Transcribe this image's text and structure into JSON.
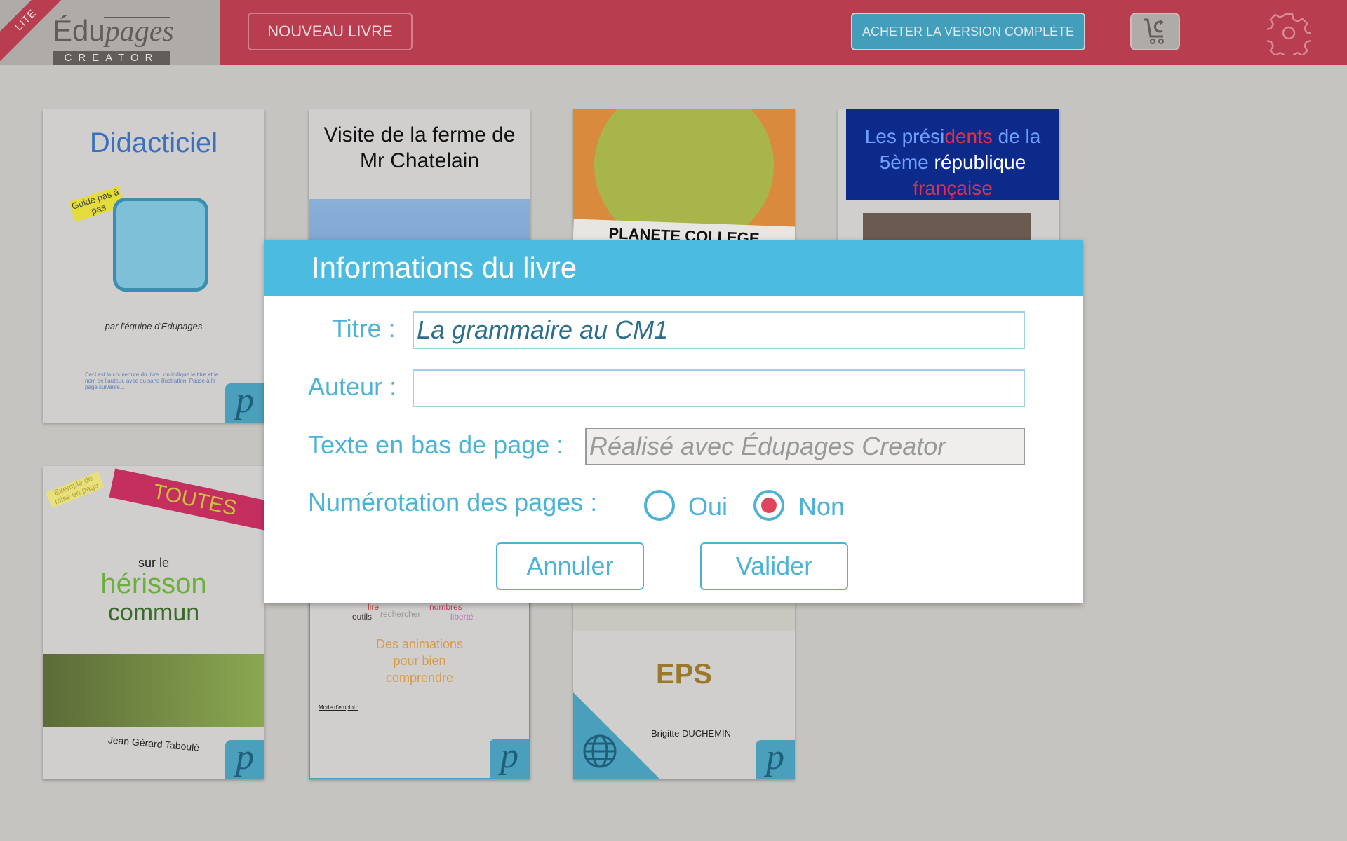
{
  "header": {
    "lite_badge": "LITE",
    "logo_main": "Édu",
    "logo_italic": "pages",
    "logo_sub": "CREATOR",
    "new_book": "NOUVEAU LIVRE",
    "buy_full": "ACHETER LA VERSION COMPLÈTE",
    "cart_icon": "cart-refresh-icon",
    "settings_icon": "gear-icon"
  },
  "books": [
    {
      "title": "Didacticiel",
      "tag": "Guide pas à pas",
      "author": "par l'équipe d'Édupages",
      "note": "Ceci est la couverture du livre : on indique le titre et le nom de l'auteur, avec ou sans illustration. Passe à la page suivante..."
    },
    {
      "title": "Visite de la ferme de Mr Chatelain"
    },
    {
      "title": "PLANETE COLLEGE"
    },
    {
      "title_parts": [
        "Les prési",
        "dents",
        " de la ",
        "5ème ",
        "république ",
        "française"
      ]
    },
    {
      "tag": "Exemple de mise en page",
      "banner": "TOUTES",
      "pre": "sur le",
      "title1": "hérisson",
      "title2": "commun",
      "author": "Jean Gérard Taboulé"
    },
    {
      "words": [
        "lire",
        "nombres",
        "outils",
        "rechercher",
        "liberté"
      ],
      "subtitle": "Des animations pour bien comprendre",
      "note_title": "Mode d'emploi :"
    },
    {
      "title": "EPS",
      "author": "Brigitte DUCHEMIN"
    }
  ],
  "dialog": {
    "title": "Informations du livre",
    "title_label": "Titre :",
    "title_value": "La grammaire au CM1",
    "author_label": "Auteur :",
    "author_value": "",
    "footer_label": "Texte en bas de page :",
    "footer_placeholder": "Réalisé avec Édupages Creator",
    "numbering_label": "Numérotation des pages :",
    "options": [
      "Oui",
      "Non"
    ],
    "selected": "Non",
    "cancel": "Annuler",
    "validate": "Valider"
  },
  "colors": {
    "header": "#b83d4f",
    "accent": "#4bbbe0",
    "radio_selected": "#e0455e",
    "buy_button": "#429ebb"
  }
}
